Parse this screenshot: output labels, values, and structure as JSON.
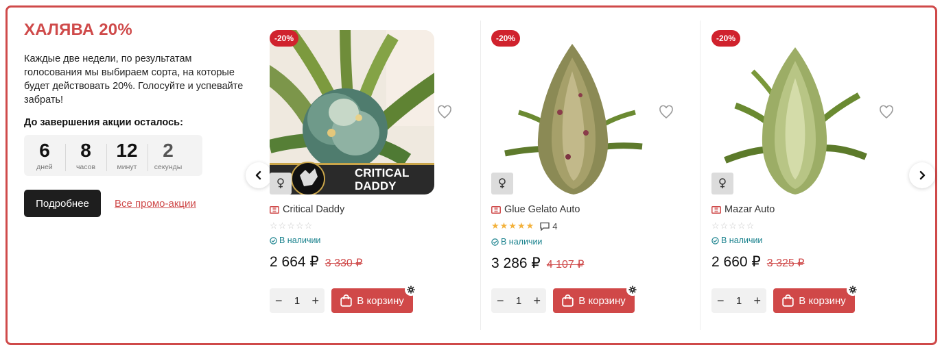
{
  "promo": {
    "title": "ХАЛЯВА 20%",
    "text": "Каждые две недели, по результатам голосования мы выбираем сорта, на которые будет действовать 20%. Голосуйте и успевайте забрать!",
    "countdown_label": "До завершения акции осталось:",
    "countdown": [
      {
        "value": "6",
        "label": "дней"
      },
      {
        "value": "8",
        "label": "часов"
      },
      {
        "value": "12",
        "label": "минут"
      },
      {
        "value": "2",
        "label": "секунды"
      }
    ],
    "more_button": "Подробнее",
    "all_promos_link": "Все промо-акции"
  },
  "products": [
    {
      "badge": "-20%",
      "image_caption": "CRITICAL DADDY",
      "name": "Critical Daddy",
      "rating": 0,
      "reviews": "",
      "stock": "В наличии",
      "price": "2 664 ₽",
      "old_price": "3 330 ₽",
      "qty": "1",
      "cart_label": "В корзину"
    },
    {
      "badge": "-20%",
      "image_caption": "",
      "name": "Glue Gelato Auto",
      "rating": 5,
      "reviews": "4",
      "stock": "В наличии",
      "price": "3 286 ₽",
      "old_price": "4 107 ₽",
      "qty": "1",
      "cart_label": "В корзину"
    },
    {
      "badge": "-20%",
      "image_caption": "",
      "name": "Mazar Auto",
      "rating": 0,
      "reviews": "",
      "stock": "В наличии",
      "price": "2 660 ₽",
      "old_price": "3 325 ₽",
      "qty": "1",
      "cart_label": "В корзину"
    }
  ],
  "icons": {
    "arrow_left": "chevron-left-icon",
    "arrow_right": "chevron-right-icon",
    "favorite": "heart-icon",
    "sex": "female-icon",
    "ticket": "ticket-icon",
    "stock": "check-circle-icon",
    "cart": "shopping-bag-icon",
    "settings": "gear-icon"
  },
  "colors": {
    "accent": "#cf4a4a",
    "badge": "#d0222d",
    "stock": "#17808c",
    "star": "#f3b13a",
    "dark_button": "#1e1e1e"
  }
}
